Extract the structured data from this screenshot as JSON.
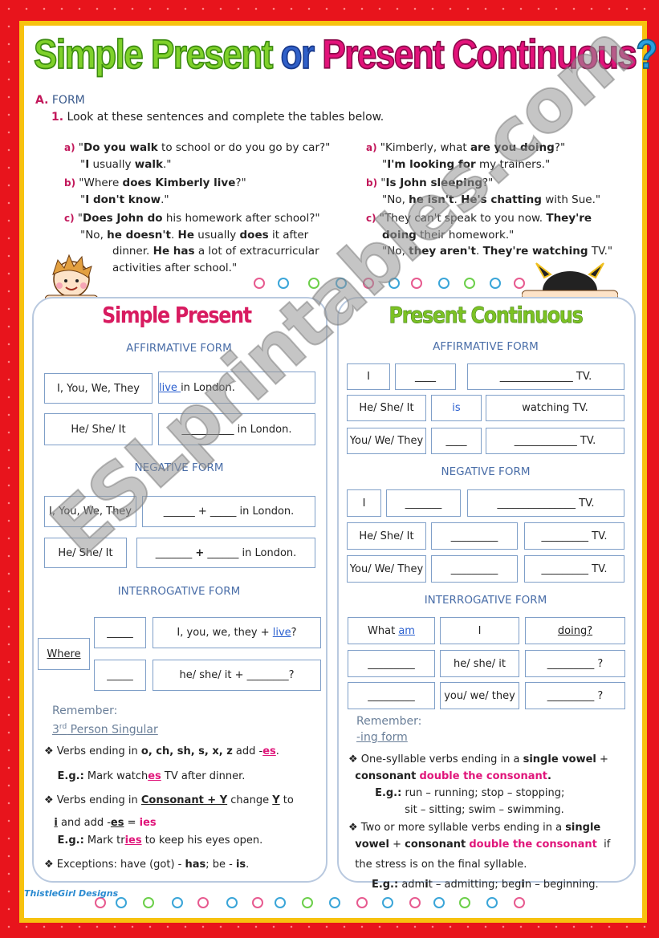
{
  "title": {
    "w1": "Simple Present",
    "w2": "or",
    "w3": "Present Continuous",
    "w4": "?"
  },
  "section": {
    "label": "A.",
    "text": "FORM"
  },
  "task": {
    "num": "1.",
    "text": "Look at these sentences and complete the tables below."
  },
  "left_sentences": [
    {
      "label": "a)",
      "lines": [
        [
          [
            "\"",
            ""
          ],
          [
            "Do you walk",
            "b"
          ],
          [
            " to school or do you go by car?\"",
            ""
          ]
        ],
        [
          [
            "\"",
            ""
          ],
          [
            "I",
            "b"
          ],
          [
            " usually ",
            ""
          ],
          [
            "walk",
            "b"
          ],
          [
            ".\"",
            ""
          ]
        ]
      ]
    },
    {
      "label": "b)",
      "lines": [
        [
          [
            "\"Where ",
            ""
          ],
          [
            "does Kimberly live",
            "b"
          ],
          [
            "?\"",
            ""
          ]
        ],
        [
          [
            "\"",
            ""
          ],
          [
            "I don't know",
            "b"
          ],
          [
            ".\"",
            ""
          ]
        ]
      ]
    },
    {
      "label": "c)",
      "lines": [
        [
          [
            "\"",
            ""
          ],
          [
            "Does John do",
            "b"
          ],
          [
            " his homework after school?\"",
            ""
          ]
        ],
        [
          [
            "\"No, ",
            ""
          ],
          [
            "he doesn't",
            "b"
          ],
          [
            ". ",
            ""
          ],
          [
            "He",
            "b"
          ],
          [
            " usually ",
            ""
          ],
          [
            "does",
            "b"
          ],
          [
            " it after",
            ""
          ]
        ],
        [
          [
            "dinner. ",
            ""
          ],
          [
            "He has",
            "b"
          ],
          [
            " a lot of extracurricular",
            ""
          ]
        ],
        [
          [
            "activities after school.\"",
            ""
          ]
        ]
      ]
    }
  ],
  "right_sentences": [
    {
      "label": "a)",
      "lines": [
        [
          [
            "\"Kimberly, what ",
            ""
          ],
          [
            "are you doing",
            "b"
          ],
          [
            "?\"",
            ""
          ]
        ],
        [
          [
            "\"",
            ""
          ],
          [
            "I'm looking for",
            "b"
          ],
          [
            " my trainers.\"",
            ""
          ]
        ]
      ]
    },
    {
      "label": "b)",
      "lines": [
        [
          [
            "\"",
            ""
          ],
          [
            "Is John sleeping",
            "b"
          ],
          [
            "?\"",
            ""
          ]
        ],
        [
          [
            "\"No, ",
            ""
          ],
          [
            "he isn't",
            "b"
          ],
          [
            ". ",
            ""
          ],
          [
            "He's chatting",
            "b"
          ],
          [
            " with Sue.\"",
            ""
          ]
        ]
      ]
    },
    {
      "label": "c)",
      "lines": [
        [
          [
            "\"They can't speak to you now. ",
            ""
          ],
          [
            "They're",
            "b"
          ]
        ],
        [
          [
            "doing",
            "b"
          ],
          [
            " their homework.\"",
            ""
          ]
        ],
        [
          [
            "\"No, ",
            ""
          ],
          [
            "they aren't",
            "b"
          ],
          [
            ". ",
            ""
          ],
          [
            "They're watching",
            "b"
          ],
          [
            " TV.\"",
            ""
          ]
        ]
      ]
    }
  ],
  "simple_present": {
    "title": "Simple Present",
    "title_color": "#d81b60",
    "affirmative": "AFFIRMATIVE FORM",
    "negative": "NEGATIVE FORM",
    "interrogative": "INTERROGATIVE FORM",
    "aff": [
      [
        "I, You, We, They",
        [
          [
            "live ",
            "u bl"
          ],
          [
            "in London.",
            ""
          ]
        ]
      ],
      [
        "He/ She/ It",
        [
          [
            "__________ in London.",
            ""
          ]
        ]
      ]
    ],
    "neg": [
      [
        "I, You, We, They",
        [
          [
            "______ + _____ in London.",
            ""
          ]
        ]
      ],
      [
        "He/ She/ It",
        [
          [
            "_______ ",
            ""
          ],
          [
            "+",
            "b"
          ],
          [
            " ______ in London.",
            ""
          ]
        ]
      ]
    ],
    "int": {
      "wh": "Where",
      "blank1": "_____",
      "blank2": "_____",
      "q1": [
        [
          "I, you, we, they + ",
          ""
        ],
        [
          "live",
          "u bl"
        ],
        [
          "?",
          ""
        ]
      ],
      "q2": [
        [
          "he/ she/ it + ________?",
          ""
        ]
      ]
    },
    "remember": "Remember:",
    "remember_topic": "3rd Person Singular",
    "rd": "rd",
    "three": "3",
    "topic_rest": " Person Singular",
    "rules": [
      [
        [
          "❖ Verbs ending in ",
          ""
        ],
        [
          "o, ch, sh, s, x, z",
          "b"
        ],
        [
          " add -",
          ""
        ],
        [
          "es",
          "p u"
        ],
        [
          ".",
          ""
        ]
      ],
      [
        [
          "    ",
          ""
        ],
        [
          "E.g.:",
          "b"
        ],
        [
          " Mark watch",
          ""
        ],
        [
          "es",
          "p u"
        ],
        [
          " TV after dinner.",
          ""
        ]
      ],
      [
        [
          "❖ Verbs ending in ",
          ""
        ],
        [
          "Consonant + Y",
          "b u"
        ],
        [
          " change ",
          ""
        ],
        [
          "Y",
          "b u"
        ],
        [
          " to",
          ""
        ]
      ],
      [
        [
          "   ",
          ""
        ],
        [
          "i",
          "b u"
        ],
        [
          " and add -",
          ""
        ],
        [
          "es",
          "b u"
        ],
        [
          " = ",
          ""
        ],
        [
          "ies",
          "p"
        ]
      ],
      [
        [
          "    ",
          ""
        ],
        [
          "E.g.:",
          "b"
        ],
        [
          " Mark tr",
          ""
        ],
        [
          "ies",
          "p u"
        ],
        [
          " to keep his eyes open.",
          ""
        ]
      ],
      [
        [
          "❖ Exceptions: have (got) - ",
          ""
        ],
        [
          "has",
          "b"
        ],
        [
          "; be - ",
          ""
        ],
        [
          "is",
          "b"
        ],
        [
          ".",
          ""
        ]
      ]
    ]
  },
  "present_continuous": {
    "title": "Present Continuous",
    "title_color": "#7cc224",
    "affirmative": "AFFIRMATIVE FORM",
    "negative": "NEGATIVE FORM",
    "interrogative": "INTERROGATIVE FORM",
    "aff": [
      [
        "I",
        "____",
        "______________  TV."
      ],
      [
        "He/ She/ It",
        "is",
        "watching TV."
      ],
      [
        "You/ We/ They",
        "____",
        "____________  TV."
      ]
    ],
    "aff_is_color": "#2a5fcf",
    "neg": [
      [
        "I",
        "_______",
        "_______________ TV."
      ],
      [
        "He/ She/ It",
        "_________",
        "_________ TV."
      ],
      [
        "You/ We/ They",
        "_________",
        "_________ TV."
      ]
    ],
    "int": [
      [
        "What am",
        "I",
        "doing?"
      ],
      [
        "_________",
        "he/ she/ it",
        "_________ ?"
      ],
      [
        "_________",
        "you/ we/ they",
        "_________ ?"
      ]
    ],
    "remember": "Remember:",
    "remember_topic": "-ing form",
    "rules": [
      [
        [
          "❖ One-syllable verbs ending in a ",
          ""
        ],
        [
          "single vowel",
          "b"
        ],
        [
          " +",
          ""
        ]
      ],
      [
        [
          "  ",
          ""
        ],
        [
          "consonant",
          "b"
        ],
        [
          " ",
          ""
        ],
        [
          "double the consonant",
          "p"
        ],
        [
          ".",
          "b"
        ]
      ],
      [
        [
          "        ",
          ""
        ],
        [
          "E.g.:",
          "b"
        ],
        [
          " run – running; stop – stopping;",
          ""
        ]
      ],
      [
        [
          "                 sit – sitting; swim – swimming.",
          ""
        ]
      ],
      [
        [
          "❖ Two or more syllable verbs ending in a ",
          ""
        ],
        [
          "single",
          "b"
        ]
      ],
      [
        [
          "  ",
          ""
        ],
        [
          "vowel",
          "b"
        ],
        [
          " + ",
          ""
        ],
        [
          "consonant",
          "b"
        ],
        [
          " ",
          ""
        ],
        [
          "double the consonant",
          "p"
        ],
        [
          "  if",
          ""
        ]
      ],
      [
        [
          "  the stress is on the final syllable.",
          ""
        ]
      ],
      [
        [
          "       ",
          ""
        ],
        [
          "E.g.:",
          "b"
        ],
        [
          " adm",
          ""
        ],
        [
          "i",
          "b"
        ],
        [
          "t – admitting; beg",
          ""
        ],
        [
          "i",
          "b"
        ],
        [
          "n – beginning.",
          ""
        ]
      ]
    ]
  },
  "watermark": "ESLprintables.com",
  "logo": "ThistleGirl Designs",
  "colors": {
    "background": "#e8141c",
    "frame": "#f7c20f",
    "accent_pink": "#e0157a",
    "table_border": "#7f9fc8",
    "heading_blue": "#4a6ea8"
  }
}
